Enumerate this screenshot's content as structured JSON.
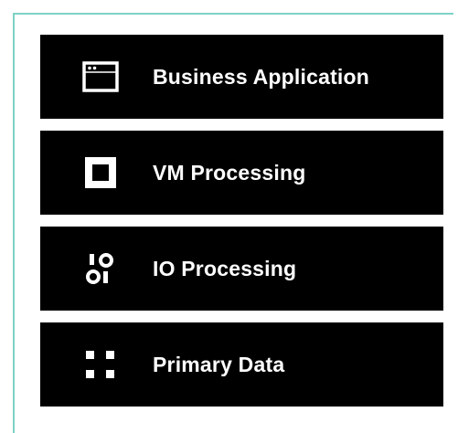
{
  "layers": [
    {
      "label": "Business Application",
      "icon": "app-window-icon"
    },
    {
      "label": "VM Processing",
      "icon": "square-icon"
    },
    {
      "label": "IO Processing",
      "icon": "io-icon"
    },
    {
      "label": "Primary Data",
      "icon": "grid-icon"
    }
  ],
  "colors": {
    "layer_bg": "#000000",
    "text": "#ffffff",
    "frame": "#7fd1c5"
  }
}
